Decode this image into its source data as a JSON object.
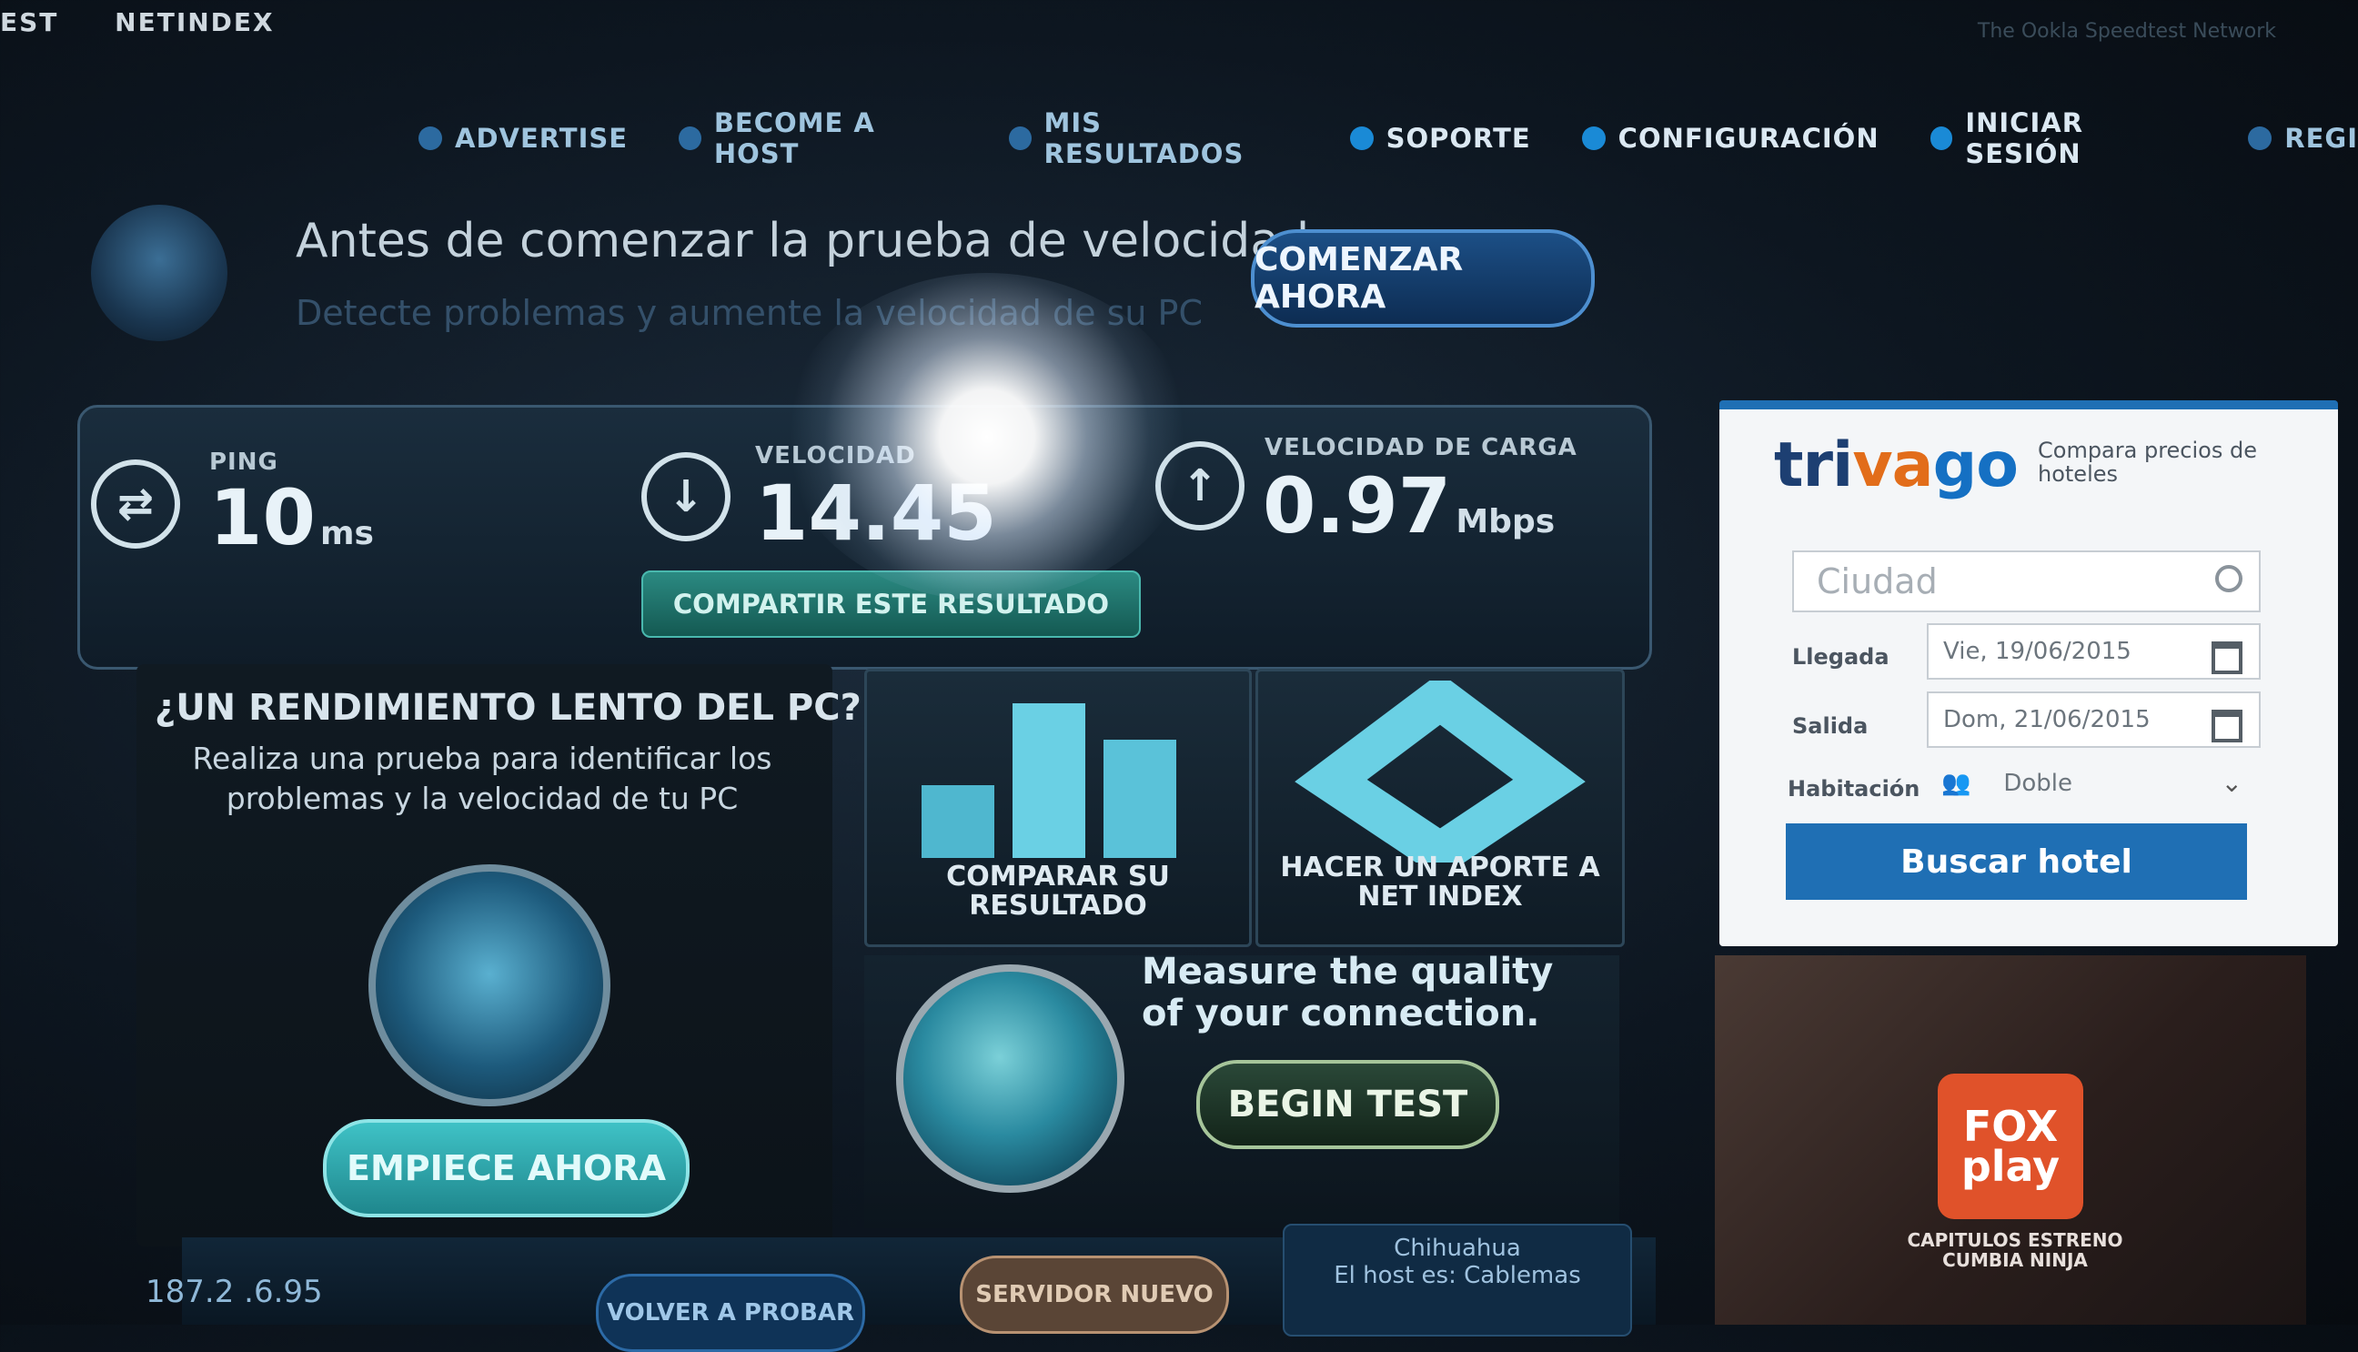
{
  "brand": {
    "left_fragment": "EST",
    "name": "NETINDEX"
  },
  "top_right_text": "The Ookla Speedtest Network",
  "nav": [
    {
      "label": "ADVERTISE",
      "icon": "megaphone-icon"
    },
    {
      "label": "BECOME A HOST",
      "icon": "server-icon"
    },
    {
      "label": "MIS RESULTADOS",
      "icon": "results-icon"
    },
    {
      "label": "SOPORTE",
      "icon": "info-icon"
    },
    {
      "label": "CONFIGURACIÓN",
      "icon": "gear-icon"
    },
    {
      "label": "INICIAR SESIÓN",
      "icon": "user-icon"
    },
    {
      "label": "REGI",
      "icon": "register-icon"
    }
  ],
  "banner": {
    "title": "Antes de comenzar la prueba de velocidad:",
    "subtitle": "Detecte problemas y aumente la velocidad de su PC",
    "button": "COMENZAR AHORA"
  },
  "results": {
    "ping": {
      "label": "PING",
      "value": "10",
      "unit": "ms"
    },
    "download": {
      "label": "VELOCIDAD",
      "value": "14.45",
      "unit": ""
    },
    "upload": {
      "label": "VELOCIDAD DE CARGA",
      "value": "0.97",
      "unit": "Mbps"
    },
    "share_button": "COMPARTIR ESTE RESULTADO"
  },
  "pc_panel": {
    "title": "¿UN RENDIMIENTO LENTO DEL PC?",
    "description": "Realiza una prueba para identificar los problemas y la velocidad de tu PC",
    "button": "EMPIECE AHORA"
  },
  "tiles": {
    "compare": "COMPARAR SU RESULTADO",
    "contribute": "HACER UN APORTE A NET INDEX"
  },
  "quality": {
    "text": "Measure the quality of your connection.",
    "button": "BEGIN TEST"
  },
  "bottom": {
    "ip": "187.2 .6.95",
    "back_button": "VOLVER A PROBAR",
    "server_button": "SERVIDOR NUEVO",
    "server_city": "Chihuahua",
    "server_host": "El host es: Cablemas"
  },
  "trivago": {
    "logo_a": "tri",
    "logo_b": "va",
    "logo_c": "go",
    "tagline": "Compara precios de hoteles",
    "city_placeholder": "Ciudad",
    "arrival_label": "Llegada",
    "arrival_value": "Vie, 19/06/2015",
    "departure_label": "Salida",
    "departure_value": "Dom, 21/06/2015",
    "room_label": "Habitación",
    "room_value": "Doble",
    "search_button": "Buscar hotel"
  },
  "ad": {
    "logo_line1": "FOX",
    "logo_line2": "play",
    "caption": "CAPITULOS ESTRENO CUMBIA NINJA"
  },
  "colors": {
    "accent": "#1f6fb4",
    "share": "#2b8a82",
    "start_pc": "#3fc2c6",
    "fox": "#e0522a"
  }
}
